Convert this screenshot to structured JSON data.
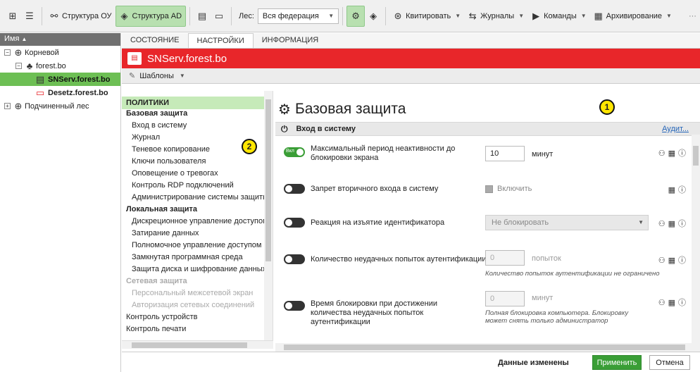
{
  "toolbar": {
    "structure_ou": "Структура ОУ",
    "structure_ad": "Структура AD",
    "forest_label": "Лес:",
    "forest_value": "Вся федерация",
    "acknowledge": "Квитировать",
    "journals": "Журналы",
    "commands": "Команды",
    "archiving": "Архивирование",
    "more": "···"
  },
  "tree": {
    "header": "Имя",
    "items": [
      {
        "label": "Корневой"
      },
      {
        "label": "forest.bo"
      },
      {
        "label": "SNServ.forest.bo"
      },
      {
        "label": "Desetz.forest.bo"
      },
      {
        "label": "Подчиненный лес"
      }
    ]
  },
  "tabs": [
    "СОСТОЯНИЕ",
    "НАСТРОЙКИ",
    "ИНФОРМАЦИЯ"
  ],
  "server_title": "SNServ.forest.bo",
  "templates_label": "Шаблоны",
  "nav": {
    "header": "ПОЛИТИКИ",
    "groups": [
      {
        "title": "Базовая защита",
        "items": [
          "Вход в систему",
          "Журнал",
          "Теневое копирование",
          "Ключи пользователя",
          "Оповещение о тревогах",
          "Контроль RDP подключений",
          "Администрирование системы защиты"
        ]
      },
      {
        "title": "Локальная защита",
        "items": [
          "Дискреционное управление доступом",
          "Затирание данных",
          "Полномочное управление доступом",
          "Замкнутая программная среда",
          "Защита диска и шифрование данных"
        ]
      },
      {
        "title": "Сетевая защита",
        "items": [
          "Персональный межсетевой экран",
          "Авторизация сетевых соединений"
        ]
      }
    ],
    "tail": [
      "Контроль устройств",
      "Контроль печати"
    ]
  },
  "content": {
    "title": "Базовая защита",
    "section": "Вход в систему",
    "audit": "Аудит...",
    "toggle_on_text": "Вкл",
    "rows": [
      {
        "label": "Максимальный период неактивности до блокировки экрана",
        "value": "10",
        "unit": "минут"
      },
      {
        "label": "Запрет вторичного входа в систему",
        "checkbox": "Включить"
      },
      {
        "label": "Реакция на изъятие идентификатора",
        "select": "Не блокировать"
      },
      {
        "label": "Количество неудачных попыток аутентификации",
        "value": "0",
        "unit": "попыток",
        "hint": "Количество попыток аутентификации не ограничено"
      },
      {
        "label": "Время блокировки при достижении количества неудачных попыток аутентификации",
        "value": "0",
        "unit": "минут",
        "hint": "Полная блокировка компьютера. Блокировку может снять только администратор"
      }
    ]
  },
  "footer": {
    "status": "Данные изменены",
    "apply": "Применить",
    "cancel": "Отмена"
  },
  "markers": [
    "1",
    "2"
  ],
  "colors": {
    "accent_red": "#e8262a",
    "accent_green": "#3a9e36",
    "selected_tree": "#6dbf54",
    "nav_header": "#c6eab9"
  }
}
